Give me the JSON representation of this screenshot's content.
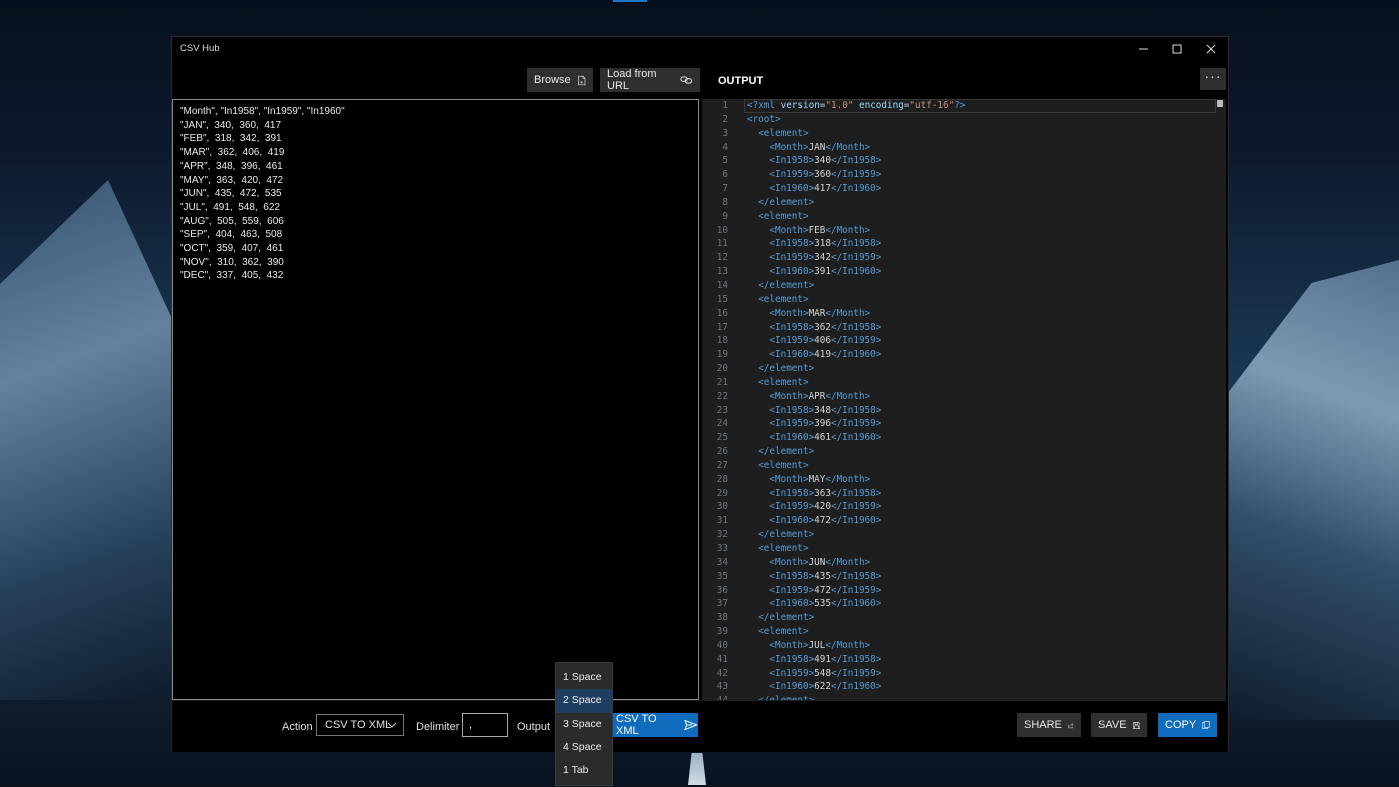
{
  "window": {
    "title": "CSV Hub"
  },
  "toolbar": {
    "browse": "Browse",
    "load_url": "Load from URL",
    "output": "OUTPUT",
    "more": "···"
  },
  "input_lines": [
    "\"Month\", \"In1958\", \"In1959\", \"In1960\"",
    "\"JAN\",  340,  360,  417",
    "\"FEB\",  318,  342,  391",
    "\"MAR\",  362,  406,  419",
    "\"APR\",  348,  396,  461",
    "\"MAY\",  363,  420,  472",
    "\"JUN\",  435,  472,  535",
    "\"JUL\",  491,  548,  622",
    "\"AUG\",  505,  559,  606",
    "\"SEP\",  404,  463,  508",
    "\"OCT\",  359,  407,  461",
    "\"NOV\",  310,  362,  390",
    "\"DEC\",  337,  405,  432"
  ],
  "output": {
    "declaration": {
      "version": "1.0",
      "encoding": "utf-16"
    },
    "root_tag": "root",
    "element_tag": "element",
    "records": [
      {
        "Month": "JAN",
        "In1958": "340",
        "In1959": "360",
        "In1960": "417"
      },
      {
        "Month": "FEB",
        "In1958": "318",
        "In1959": "342",
        "In1960": "391"
      },
      {
        "Month": "MAR",
        "In1958": "362",
        "In1959": "406",
        "In1960": "419"
      },
      {
        "Month": "APR",
        "In1958": "348",
        "In1959": "396",
        "In1960": "461"
      },
      {
        "Month": "MAY",
        "In1958": "363",
        "In1959": "420",
        "In1960": "472"
      },
      {
        "Month": "JUN",
        "In1958": "435",
        "In1959": "472",
        "In1960": "535"
      },
      {
        "Month": "JUL",
        "In1958": "491",
        "In1959": "548",
        "In1960": "622"
      }
    ]
  },
  "bottom": {
    "action_label": "Action",
    "action_value": "CSV TO XML",
    "delimiter_label": "Delimiter",
    "delimiter_value": ",",
    "output_label": "Output",
    "convert_label": "CSV TO XML",
    "share": "SHARE",
    "save": "SAVE",
    "copy": "COPY"
  },
  "indent_dropdown": {
    "options": [
      "1 Space",
      "2 Space",
      "3 Space",
      "4 Space",
      "1 Tab"
    ],
    "selected_index": 1
  },
  "colors": {
    "accent": "#0f6cbd",
    "editor_bg": "#1e1e1e",
    "xml_tag": "#569cd6",
    "xml_string": "#ce9178",
    "xml_attr": "#9cdcfe"
  }
}
